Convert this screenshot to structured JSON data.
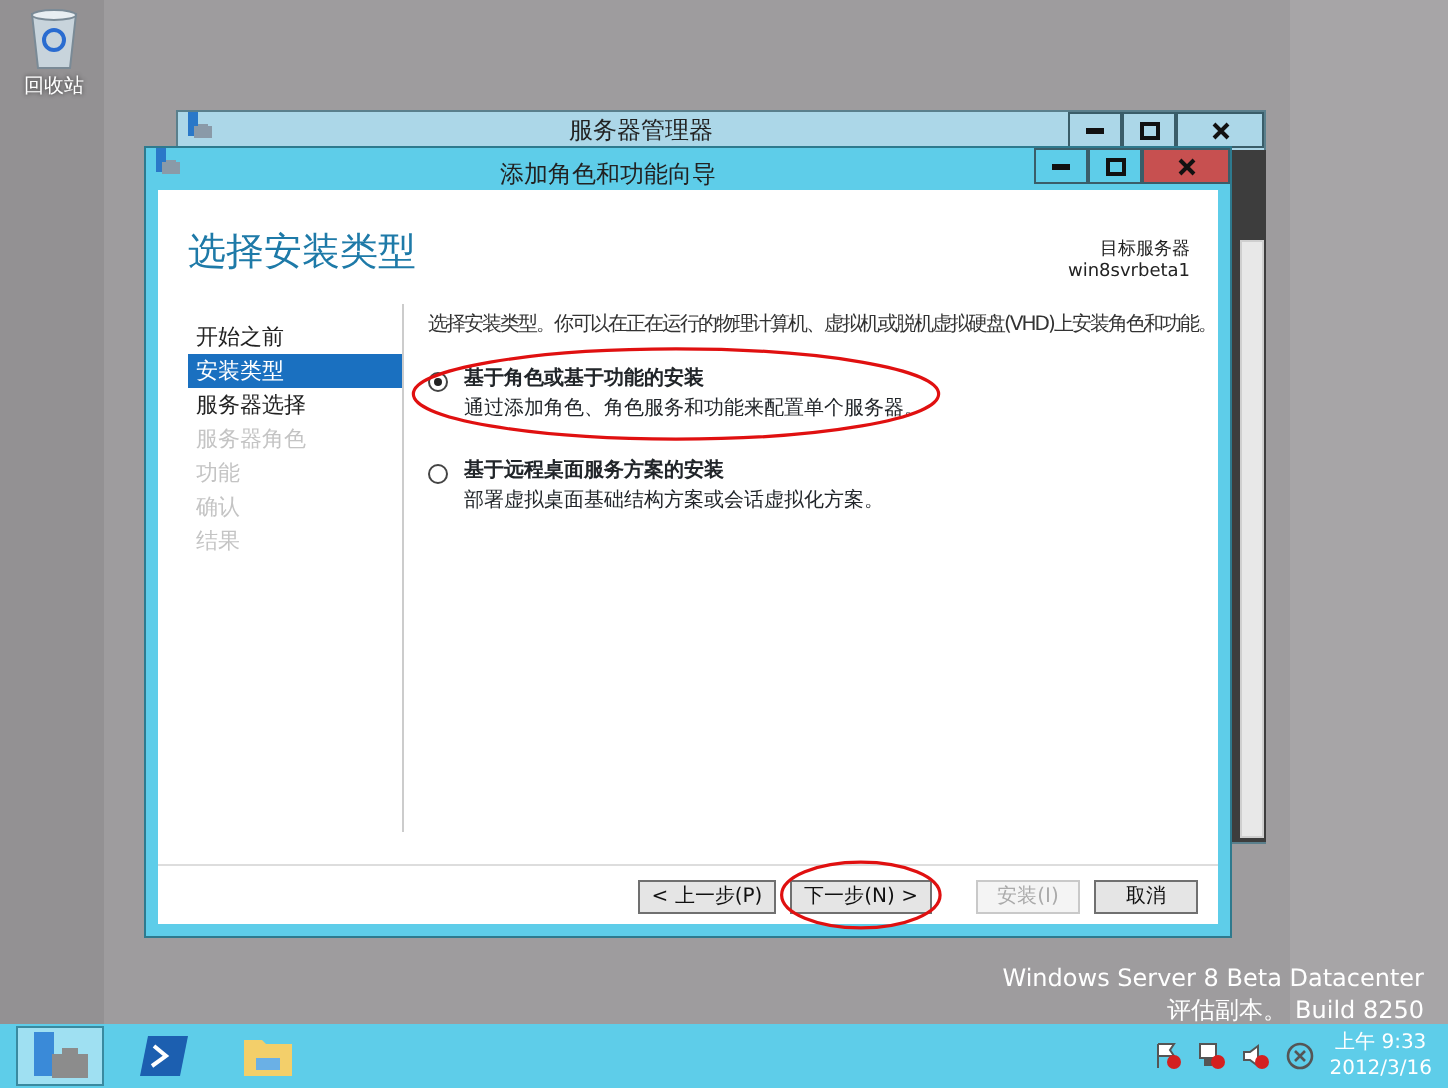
{
  "desktop": {
    "icons": [
      {
        "label": "回收站"
      }
    ]
  },
  "background_window": {
    "title": "服务器管理器"
  },
  "wizard": {
    "title": "添加角色和功能向导",
    "heading": "选择安装类型",
    "target_label": "目标服务器",
    "target_name": "win8svrbeta1",
    "steps": [
      {
        "label": "开始之前",
        "selected": false,
        "disabled": false
      },
      {
        "label": "安装类型",
        "selected": true,
        "disabled": false
      },
      {
        "label": "服务器选择",
        "selected": false,
        "disabled": false
      },
      {
        "label": "服务器角色",
        "selected": false,
        "disabled": true
      },
      {
        "label": "功能",
        "selected": false,
        "disabled": true
      },
      {
        "label": "确认",
        "selected": false,
        "disabled": true
      },
      {
        "label": "结果",
        "selected": false,
        "disabled": true
      }
    ],
    "intro": "选择安装类型。你可以在正在运行的物理计算机、虚拟机或脱机虚拟硬盘(VHD)上安装角色和功能。",
    "options": [
      {
        "title": "基于角色或基于功能的安装",
        "description": "通过添加角色、角色服务和功能来配置单个服务器。",
        "selected": true,
        "highlighted": true
      },
      {
        "title": "基于远程桌面服务方案的安装",
        "description": "部署虚拟桌面基础结构方案或会话虚拟化方案。",
        "selected": false,
        "highlighted": false
      }
    ],
    "buttons": [
      {
        "label": "< 上一步(P)",
        "disabled": false,
        "highlighted": false
      },
      {
        "label": "下一步(N) >",
        "disabled": false,
        "highlighted": true
      },
      {
        "label": "安装(I)",
        "disabled": true,
        "highlighted": false
      },
      {
        "label": "取消",
        "disabled": false,
        "highlighted": false
      }
    ]
  },
  "edition_notice": [
    "Windows Server 8 Beta Datacenter",
    "评估副本。 Build 8250"
  ],
  "taskbar": {
    "apps": [
      {
        "kind": "server-manager",
        "active": true
      },
      {
        "kind": "powershell",
        "active": false
      },
      {
        "kind": "explorer",
        "active": false
      }
    ],
    "time": "上午 9:33",
    "date": "2012/3/16"
  }
}
